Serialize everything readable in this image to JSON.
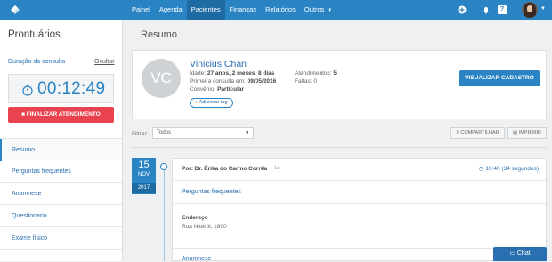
{
  "topbar": {
    "nav": [
      {
        "label": "Painel"
      },
      {
        "label": "Agenda"
      },
      {
        "label": "Pacientes",
        "active": true
      },
      {
        "label": "Finanças"
      },
      {
        "label": "Relatórios"
      },
      {
        "label": "Outros"
      }
    ],
    "help_badge": "?",
    "brand_color": "#2a84c4"
  },
  "sidebar": {
    "title": "Prontuários",
    "duration_label": "Duração da consulta",
    "hide_link": "Ocultar",
    "timer": "00:12:49",
    "end_button": "FINALIZAR ATENDIMENTO",
    "items": [
      {
        "label": "Resumo",
        "active": true
      },
      {
        "label": "Perguntas frequentes"
      },
      {
        "label": "Anamnese"
      },
      {
        "label": "Questionario"
      },
      {
        "label": "Exame físico"
      }
    ]
  },
  "main": {
    "title": "Resumo",
    "patient": {
      "initials": "VC",
      "name": "Vinicius Chan",
      "age_label": "Idade:",
      "age": "27 anos, 2 meses, 8 dias",
      "first_visit_label": "Primeira consulta em:",
      "first_visit": "09/05/2016",
      "plan_label": "Convênio:",
      "plan": "Particular",
      "add_tag": "Adicionar tag",
      "visits_label": "Atendimentos:",
      "visits": "5",
      "absences_label": "Faltas:",
      "absences": "0",
      "view_button": "VISUALIZAR CADASTRO"
    },
    "filter": {
      "label": "Filtrar:",
      "selected": "Todos",
      "share_button": "COMPARTILHAR",
      "print_button": "IMPRIMIR"
    },
    "timeline": {
      "day": "15",
      "month": "NOV",
      "year": "2017",
      "entry": {
        "author": "Por: Dr. Érika do Carmo Corrêa",
        "ago": "1s",
        "time": "10:40 (34 segundos)",
        "section1": "Perguntas frequentes",
        "address_label": "Endereço",
        "address": "Rua Niterói, 1800",
        "section2": "Anamnese"
      }
    }
  },
  "chat": {
    "label": "Chat"
  }
}
